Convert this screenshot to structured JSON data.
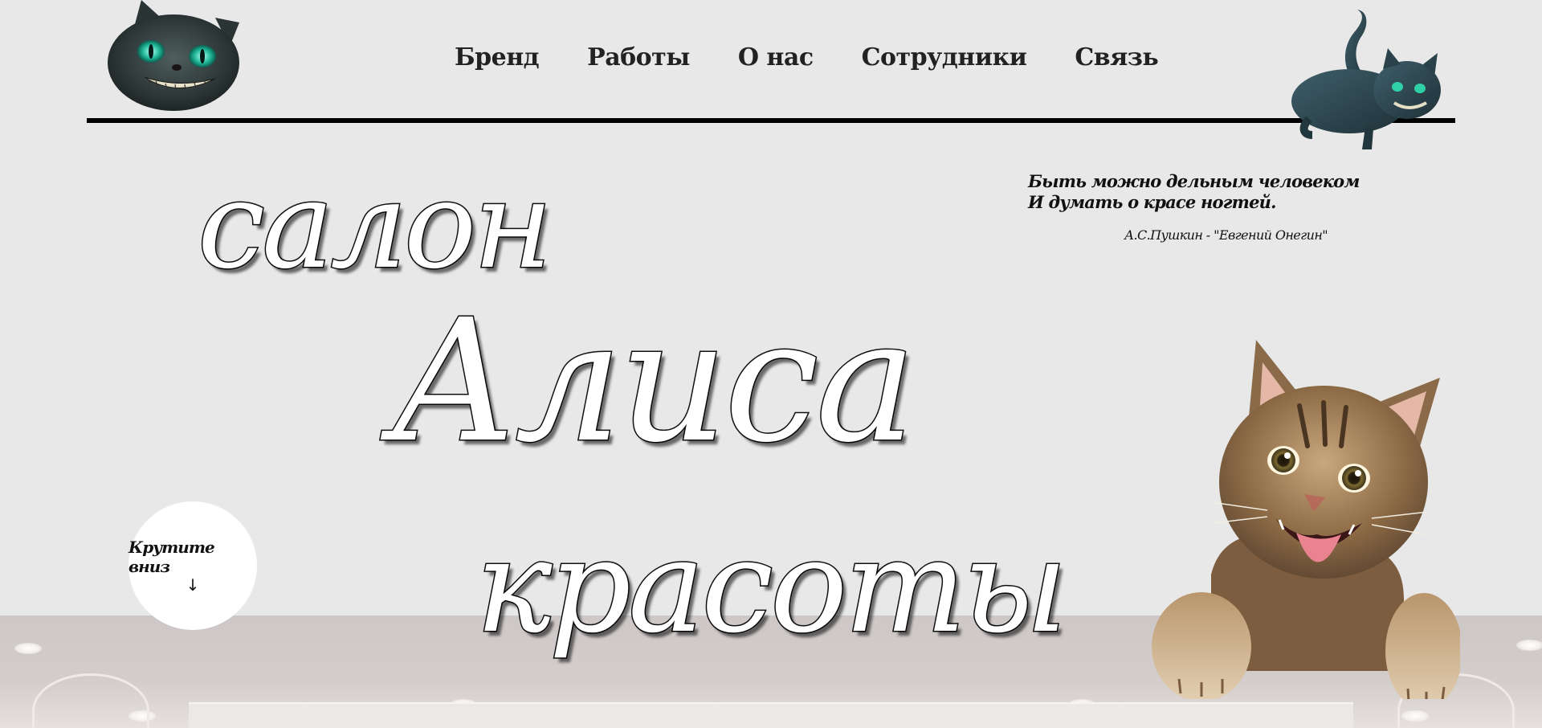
{
  "nav": {
    "items": [
      {
        "label": "Бренд"
      },
      {
        "label": "Работы"
      },
      {
        "label": "О нас"
      },
      {
        "label": "Сотрудники"
      },
      {
        "label": "Связь"
      }
    ]
  },
  "hero": {
    "word1": "салон",
    "word2": "Алиса",
    "word3": "красоты"
  },
  "quote": {
    "line1": "Быть можно дельным человеком",
    "line2": "И думать о красе ногтей.",
    "author": "А.С.Пушкин - \"Евгений Онегин\""
  },
  "scroll": {
    "label": "Крутите вниз",
    "arrow": "↓"
  },
  "images": {
    "left_cat": "cheshire-cat-head-icon",
    "right_cat": "cheshire-cat-lying-icon",
    "kitten": "tabby-kitten-image",
    "background": "salon-interior-photo"
  },
  "colors": {
    "background": "#e8e8e8",
    "rule": "#000000",
    "headline_fill": "#ffffff",
    "headline_outline": "#111111"
  }
}
